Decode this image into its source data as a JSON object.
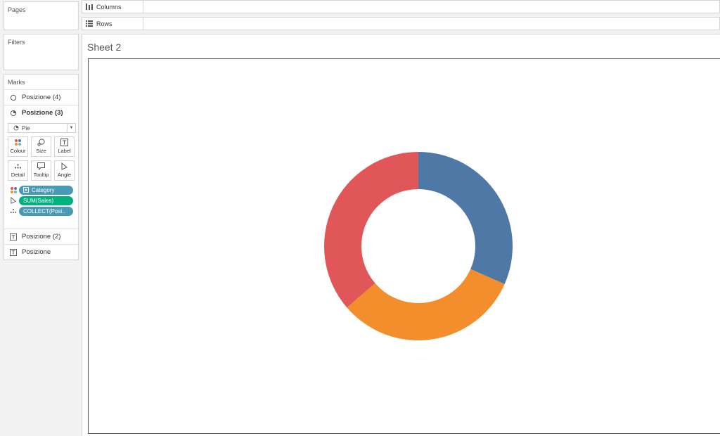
{
  "pages": {
    "title": "Pages"
  },
  "filters": {
    "title": "Filters"
  },
  "marks": {
    "title": "Marks",
    "layers": [
      {
        "label": "Posizione (4)",
        "icon": "circle-icon",
        "active": false
      },
      {
        "label": "Posizione (3)",
        "icon": "pie-icon",
        "active": true
      }
    ],
    "mark_type": "Pie",
    "buttons": {
      "colour": "Colour",
      "size": "Size",
      "label": "Label",
      "detail": "Detail",
      "tooltip": "Tooltip",
      "angle": "Angle"
    },
    "pills": [
      {
        "label": "Category",
        "type": "colour",
        "color": "#4a9ab5"
      },
      {
        "label": "SUM(Sales)",
        "type": "angle",
        "color": "#00b180"
      },
      {
        "label": "COLLECT(Posi..",
        "type": "detail",
        "color": "#4a9ab5"
      }
    ],
    "lower_layers": [
      {
        "label": "Posizione (2)",
        "icon": "text-icon"
      },
      {
        "label": "Posizione",
        "icon": "text-icon"
      }
    ]
  },
  "shelves": {
    "columns": "Columns",
    "rows": "Rows"
  },
  "sheet": {
    "title": "Sheet 2"
  },
  "chart_data": {
    "type": "pie",
    "donut": true,
    "categories": [
      "",
      "",
      ""
    ],
    "values": [
      31.6,
      32.1,
      36.3
    ],
    "colors": [
      "#4e79a7",
      "#f28e2b",
      "#e15759"
    ],
    "start_angle_deg": 0
  }
}
